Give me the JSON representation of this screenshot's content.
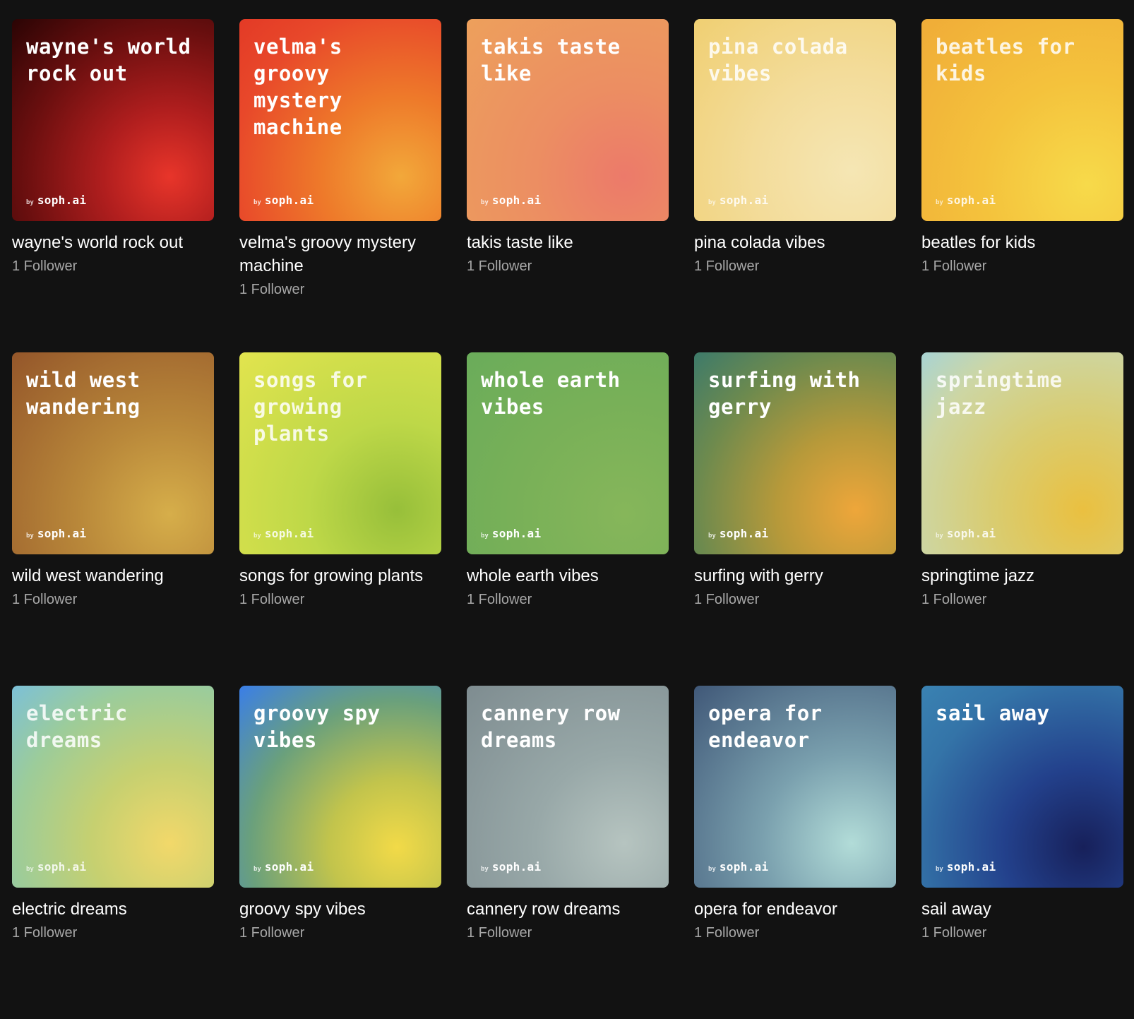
{
  "brand_by": "by",
  "brand_name": "soph.ai",
  "playlists": [
    {
      "cover_title": "wayne's world rock out",
      "title": "wayne's world rock out",
      "followers": "1 Follower",
      "colors": [
        "#e8352a",
        "#2a0404"
      ]
    },
    {
      "cover_title": "velma's groovy mystery machine",
      "title": "velma's groovy mystery machine",
      "followers": "1 Follower",
      "colors": [
        "#f2a83a",
        "#e33a26"
      ]
    },
    {
      "cover_title": "takis taste like",
      "title": "takis taste like",
      "followers": "1 Follower",
      "colors": [
        "#ec7a6a",
        "#eda05c"
      ]
    },
    {
      "cover_title": "pina colada vibes",
      "title": "pina colada vibes",
      "followers": "1 Follower",
      "colors": [
        "#f5e6b4",
        "#f0cf72"
      ]
    },
    {
      "cover_title": "beatles for kids",
      "title": "beatles for kids",
      "followers": "1 Follower",
      "colors": [
        "#f7da4a",
        "#f0ac38"
      ]
    },
    {
      "cover_title": "wild west wandering",
      "title": "wild west wandering",
      "followers": "1 Follower",
      "colors": [
        "#d6ae4a",
        "#94562a"
      ]
    },
    {
      "cover_title": "songs for growing plants",
      "title": "songs for growing plants",
      "followers": "1 Follower",
      "colors": [
        "#97bf3a",
        "#e2e44e"
      ]
    },
    {
      "cover_title": "whole earth vibes",
      "title": "whole earth vibes",
      "followers": "1 Follower",
      "colors": [
        "#86b65a",
        "#6aac5a"
      ]
    },
    {
      "cover_title": "surfing with gerry",
      "title": "surfing with gerry",
      "followers": "1 Follower",
      "colors": [
        "#eea63a",
        "#3d7a6a"
      ]
    },
    {
      "cover_title": "springtime jazz",
      "title": "springtime jazz",
      "followers": "1 Follower",
      "colors": [
        "#eac040",
        "#a8d4d4"
      ]
    },
    {
      "cover_title": "electric dreams",
      "title": "electric dreams",
      "followers": "1 Follower",
      "colors": [
        "#f2d86a",
        "#7cc0d8"
      ]
    },
    {
      "cover_title": "groovy spy vibes",
      "title": "groovy spy vibes",
      "followers": "1 Follower",
      "colors": [
        "#f2da48",
        "#3a7ee8"
      ]
    },
    {
      "cover_title": "cannery row dreams",
      "title": "cannery row dreams",
      "followers": "1 Follower",
      "colors": [
        "#b6c4c0",
        "#7e8c90"
      ]
    },
    {
      "cover_title": "opera for endeavor",
      "title": "opera for endeavor",
      "followers": "1 Follower",
      "colors": [
        "#b2dcd8",
        "#405878"
      ]
    },
    {
      "cover_title": "sail away",
      "title": "sail away",
      "followers": "1 Follower",
      "colors": [
        "#17205a",
        "#3a82b2"
      ]
    }
  ]
}
